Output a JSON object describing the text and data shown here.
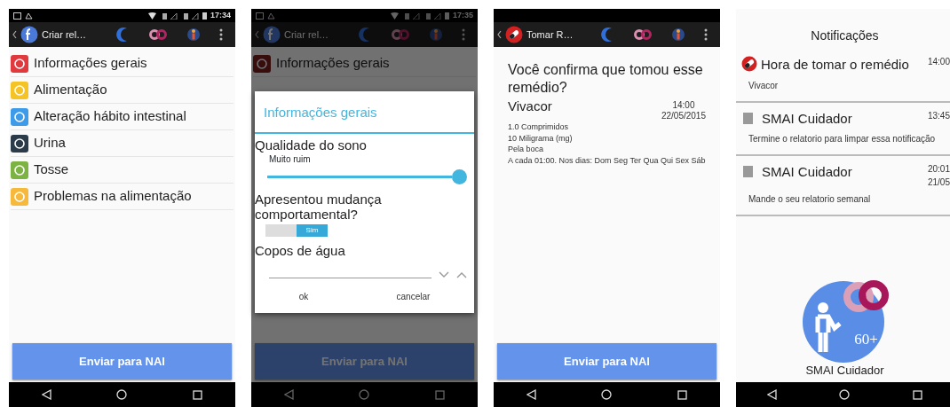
{
  "screens": [
    {
      "kind": "menu",
      "status_bar": {
        "time": "17:34"
      },
      "toolbar": {
        "title": "Criar rel…"
      },
      "items": [
        {
          "label": "Informações gerais",
          "color": "#e0393e"
        },
        {
          "label": "Alimentação",
          "color": "#f6c325"
        },
        {
          "label": "Alteração hábito intestinal",
          "color": "#3e9be9"
        },
        {
          "label": "Urina",
          "color": "#2c3b4a"
        },
        {
          "label": "Tosse",
          "color": "#7cb342"
        },
        {
          "label": "Problemas na alimentação",
          "color": "#f6b93b"
        }
      ],
      "button": {
        "label": "Enviar para NAI"
      }
    },
    {
      "kind": "dialog",
      "status_bar": {
        "time": "17:35"
      },
      "toolbar": {
        "title": "Criar rel…"
      },
      "items": [
        {
          "label": "Informações gerais"
        }
      ],
      "dialog": {
        "title": "Informações gerais",
        "fields": [
          {
            "kind": "slider",
            "label": "Qualidade do sono",
            "value": "Muito ruim",
            "level": 1
          },
          {
            "kind": "switch",
            "label": "Apresentou mudança comportamental?",
            "on": true,
            "state_label": "Sim"
          },
          {
            "kind": "number",
            "label": "Copos de água"
          }
        ],
        "buttons": [
          "ok",
          "cancelar"
        ]
      },
      "button": {
        "label": "Enviar para NAI"
      }
    },
    {
      "kind": "confirm",
      "toolbar": {
        "title": "Tomar R…"
      },
      "question": "Você confirma que tomou esse remédio?",
      "medicine": {
        "name": "Vivacor",
        "time": "14:00",
        "date": "22/05/2015",
        "details": [
          "1.0 Comprimidos",
          "10 Miligrama (mg)",
          "Pela boca",
          "A cada 01:00. Nos dias: Dom Seg Ter Qua Qui Sex Sáb"
        ]
      },
      "button": {
        "label": "Enviar para NAI"
      }
    },
    {
      "kind": "notifications",
      "title": "Notificações",
      "items": [
        {
          "kind": "reminder",
          "title": "Hora de tomar o remédio",
          "text": "Vivacor",
          "time": "14:00"
        },
        {
          "kind": "app",
          "title": "SMAI Cuidador",
          "text": "Termine o relatorio para limpar essa notificação",
          "time": "13:45"
        },
        {
          "kind": "app",
          "title": "SMAI Cuidador",
          "text": "Mande o seu relatorio semanal",
          "time": "20:01",
          "date": "21/05"
        }
      ],
      "logo": {
        "badge": "60+",
        "caption": "SMAI Cuidador"
      }
    }
  ]
}
